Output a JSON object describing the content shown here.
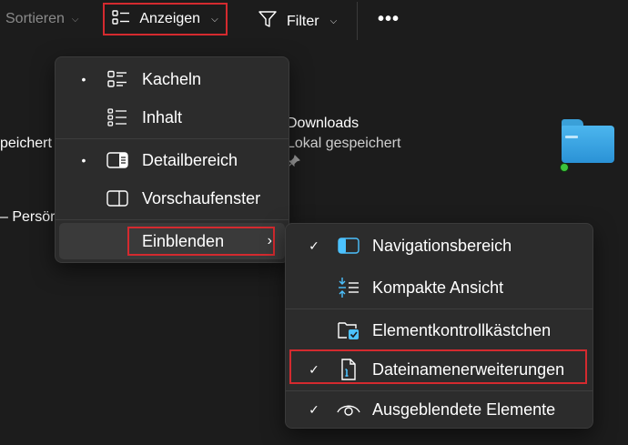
{
  "toolbar": {
    "sort_label": "Sortieren",
    "show_label": "Anzeigen",
    "filter_label": "Filter",
    "more_label": "•••"
  },
  "background": {
    "left_text_1": "peichert",
    "left_text_2": "– Persör",
    "folder_name": "Downloads",
    "folder_status": "Lokal gespeichert"
  },
  "view_menu": {
    "items": [
      {
        "label": "Kacheln",
        "marker": "•",
        "icon": "tiles-icon"
      },
      {
        "label": "Inhalt",
        "marker": "",
        "icon": "content-icon"
      },
      {
        "label": "Detailbereich",
        "marker": "•",
        "icon": "details-pane-icon"
      },
      {
        "label": "Vorschaufenster",
        "marker": "",
        "icon": "preview-pane-icon"
      },
      {
        "label": "Einblenden",
        "marker": "",
        "icon": "",
        "submenu_arrow": "›"
      }
    ]
  },
  "show_submenu": {
    "items": [
      {
        "label": "Navigationsbereich",
        "marker": "✓",
        "icon": "navigation-pane-icon"
      },
      {
        "label": "Kompakte Ansicht",
        "marker": "",
        "icon": "compact-view-icon"
      },
      {
        "label": "Elementkontrollkästchen",
        "marker": "",
        "icon": "item-checkboxes-icon"
      },
      {
        "label": "Dateinamenerweiterungen",
        "marker": "✓",
        "icon": "file-extension-icon"
      },
      {
        "label": "Ausgeblendete Elemente",
        "marker": "✓",
        "icon": "hidden-items-eye-icon"
      }
    ]
  },
  "colors": {
    "background": "#1c1c1c",
    "menu": "#2c2c2c",
    "highlight_border": "#d42a2f",
    "accent_blue": "#4cc2ff"
  }
}
